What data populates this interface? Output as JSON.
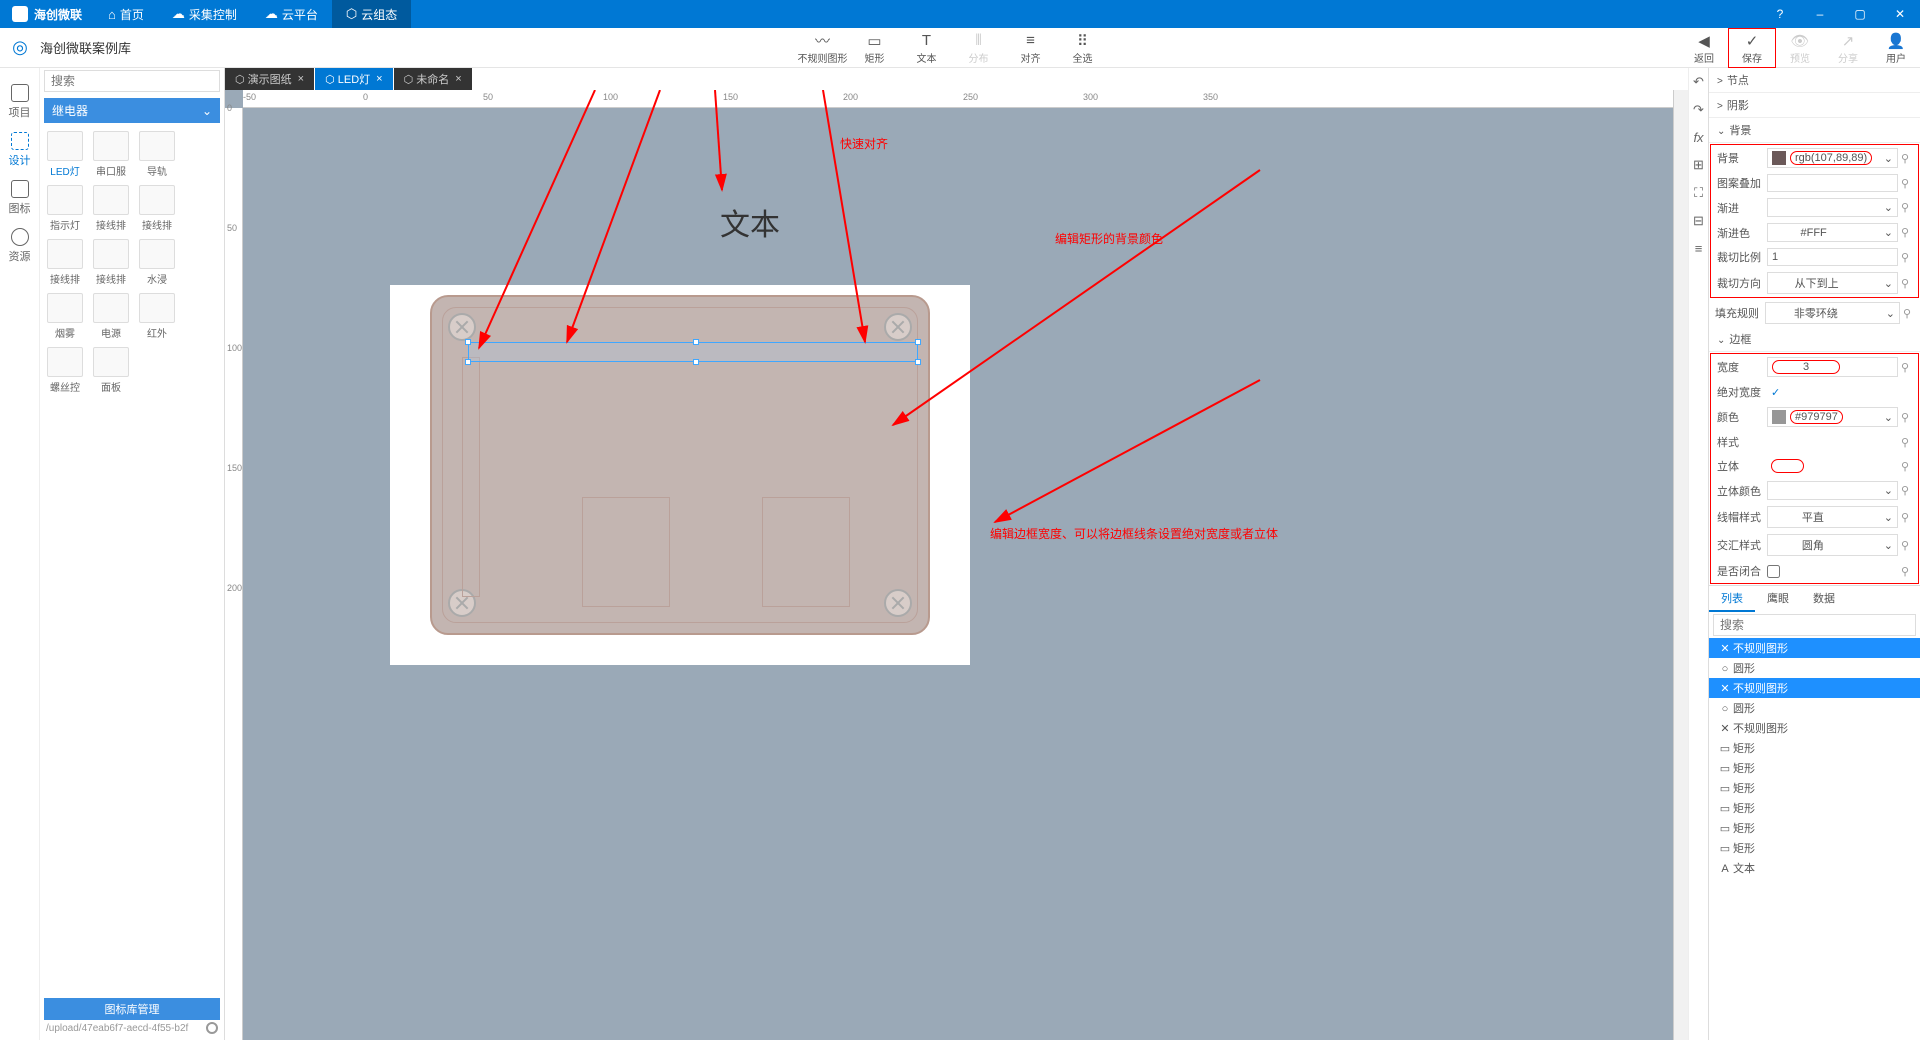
{
  "app": {
    "name": "海创微联"
  },
  "topMenu": [
    "首页",
    "采集控制",
    "云平台",
    "云组态"
  ],
  "windowControls": [
    "–",
    "▢",
    "✕"
  ],
  "subtitle": "海创微联案例库",
  "leftNav": [
    {
      "label": "项目"
    },
    {
      "label": "设计"
    },
    {
      "label": "图标"
    },
    {
      "label": "资源"
    }
  ],
  "search": {
    "placeholder": "搜索"
  },
  "libHeader": "继电器",
  "libItems": [
    "LED灯",
    "串口服",
    "导轨",
    "指示灯",
    "接线排",
    "接线排",
    "接线排",
    "接线排",
    "水浸",
    "烟雾",
    "电源",
    "红外",
    "螺丝控",
    "面板"
  ],
  "libFooter": {
    "title": "图标库管理",
    "path": "/upload/47eab6f7-aecd-4f55-b2f"
  },
  "tools": [
    {
      "label": "不规则图形",
      "glyph": "〰"
    },
    {
      "label": "矩形",
      "glyph": "▭"
    },
    {
      "label": "文本",
      "glyph": "T"
    },
    {
      "label": "分布",
      "glyph": "⦀",
      "disabled": true
    },
    {
      "label": "对齐",
      "glyph": "≡"
    },
    {
      "label": "全选",
      "glyph": "⠿"
    }
  ],
  "toolRight": [
    {
      "label": "返回",
      "glyph": "◀"
    },
    {
      "label": "保存",
      "glyph": "✓",
      "highlight": true
    },
    {
      "label": "预览",
      "glyph": "👁",
      "disabled": true
    },
    {
      "label": "分享",
      "glyph": "↗",
      "disabled": true
    },
    {
      "label": "用户",
      "glyph": "👤"
    }
  ],
  "tabs": [
    {
      "label": "演示图纸",
      "active": false
    },
    {
      "label": "LED灯",
      "active": true
    },
    {
      "label": "未命名",
      "active": false
    }
  ],
  "rulerH": [
    "-50",
    "0",
    "50",
    "100",
    "150",
    "200",
    "250",
    "300",
    "350"
  ],
  "rulerV": [
    "0",
    "50",
    "100",
    "150",
    "200"
  ],
  "canvasText": "文本",
  "annotations": {
    "a1": "快速对齐",
    "a2": "编辑矩形的背景颜色",
    "a3": "编辑边框宽度、可以将边框线条设置绝对宽度或者立体"
  },
  "panels": {
    "node": "节点",
    "shadow": "阴影",
    "background": "背景",
    "border": "边框"
  },
  "bgProps": {
    "bg": {
      "label": "背景",
      "value": "rgb(107,89,89)",
      "color": "#6b5959"
    },
    "overlay": {
      "label": "图案叠加",
      "value": ""
    },
    "gradient": {
      "label": "渐进",
      "value": ""
    },
    "gradColor": {
      "label": "渐进色",
      "value": "#FFF"
    },
    "cropRatio": {
      "label": "裁切比例",
      "value": "1"
    },
    "cropDir": {
      "label": "裁切方向",
      "value": "从下到上"
    }
  },
  "fillRule": {
    "label": "填充规则",
    "value": "非零环绕"
  },
  "borderProps": {
    "width": {
      "label": "宽度",
      "value": "3"
    },
    "absWidth": {
      "label": "绝对宽度",
      "checked": true
    },
    "color": {
      "label": "颜色",
      "value": "#979797",
      "swatch": "#979797"
    },
    "style": {
      "label": "样式",
      "value": ""
    },
    "solid3d": {
      "label": "立体",
      "value": ""
    },
    "solid3dColor": {
      "label": "立体颜色",
      "value": ""
    },
    "capStyle": {
      "label": "线帽样式",
      "value": "平直"
    },
    "joinStyle": {
      "label": "交汇样式",
      "value": "圆角"
    },
    "closed": {
      "label": "是否闭合",
      "checked": false
    }
  },
  "bottomTabs": [
    "列表",
    "鹰眼",
    "数据"
  ],
  "layerSearch": "搜索",
  "layers": [
    {
      "name": "不规则图形",
      "ico": "✕",
      "sel": true
    },
    {
      "name": "圆形",
      "ico": "○"
    },
    {
      "name": "不规则图形",
      "ico": "✕",
      "sel": true
    },
    {
      "name": "圆形",
      "ico": "○"
    },
    {
      "name": "不规则图形",
      "ico": "✕"
    },
    {
      "name": "矩形",
      "ico": "▭"
    },
    {
      "name": "矩形",
      "ico": "▭"
    },
    {
      "name": "矩形",
      "ico": "▭"
    },
    {
      "name": "矩形",
      "ico": "▭"
    },
    {
      "name": "矩形",
      "ico": "▭"
    },
    {
      "name": "矩形",
      "ico": "▭"
    },
    {
      "name": "文本",
      "ico": "A"
    }
  ]
}
